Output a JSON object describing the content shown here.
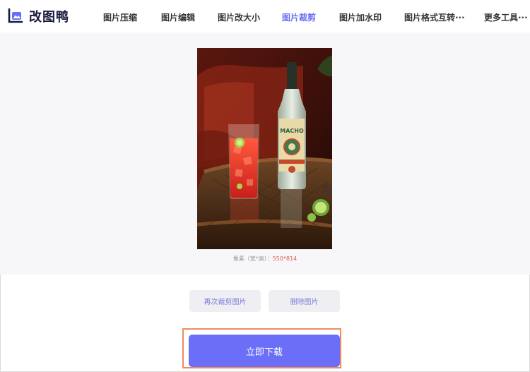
{
  "header": {
    "logo_text": "改图鸭",
    "nav": [
      {
        "label": "图片压缩"
      },
      {
        "label": "图片编辑"
      },
      {
        "label": "图片改大小"
      },
      {
        "label": "图片裁剪"
      },
      {
        "label": "图片加水印"
      },
      {
        "label": "图片格式互转···"
      },
      {
        "label": "更多工具···"
      }
    ],
    "active_nav": "图片裁剪"
  },
  "preview": {
    "image_icon": "cropped-photo-bottle-and-cocktail",
    "bottle_label": "MACHO",
    "pixel_label": "像素（宽*高）：",
    "pixel_value": "550*814"
  },
  "actions": {
    "recrop_label": "再次裁剪图片",
    "delete_label": "删除图片",
    "download_label": "立即下载"
  },
  "colors": {
    "accent": "#6b6ff7",
    "highlight": "#f08a5d",
    "pixel_value": "#e15a4a"
  }
}
